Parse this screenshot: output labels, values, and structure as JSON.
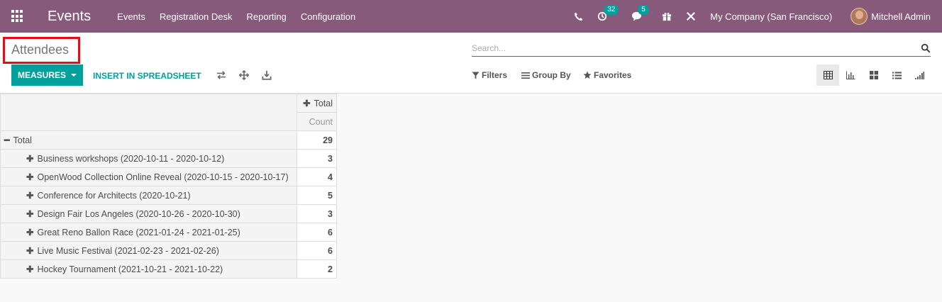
{
  "app": {
    "title": "Events"
  },
  "menu": [
    "Events",
    "Registration Desk",
    "Reporting",
    "Configuration"
  ],
  "nav": {
    "activities_badge": "32",
    "messages_badge": "5",
    "company": "My Company (San Francisco)",
    "user": "Mitchell Admin"
  },
  "breadcrumb": "Attendees",
  "search": {
    "placeholder": "Search..."
  },
  "toolbar": {
    "measures_label": "MEASURES",
    "spreadsheet_label": "INSERT IN SPREADSHEET",
    "filters_label": "Filters",
    "groupby_label": "Group By",
    "favorites_label": "Favorites"
  },
  "pivot": {
    "col_header": "Total",
    "measure": "Count",
    "total_label": "Total",
    "total_value": "29",
    "rows": [
      {
        "label": "Business workshops (2020-10-11 - 2020-10-12)",
        "value": "3"
      },
      {
        "label": "OpenWood Collection Online Reveal (2020-10-15 - 2020-10-17)",
        "value": "4"
      },
      {
        "label": "Conference for Architects (2020-10-21)",
        "value": "5"
      },
      {
        "label": "Design Fair Los Angeles (2020-10-26 - 2020-10-30)",
        "value": "3"
      },
      {
        "label": "Great Reno Ballon Race (2021-01-24 - 2021-01-25)",
        "value": "6"
      },
      {
        "label": "Live Music Festival (2021-02-23 - 2021-02-26)",
        "value": "6"
      },
      {
        "label": "Hockey Tournament (2021-10-21 - 2021-10-22)",
        "value": "2"
      }
    ]
  },
  "colors": {
    "navbar": "#875a7b",
    "accent": "#00a09d",
    "highlight_box": "#e0101a"
  }
}
